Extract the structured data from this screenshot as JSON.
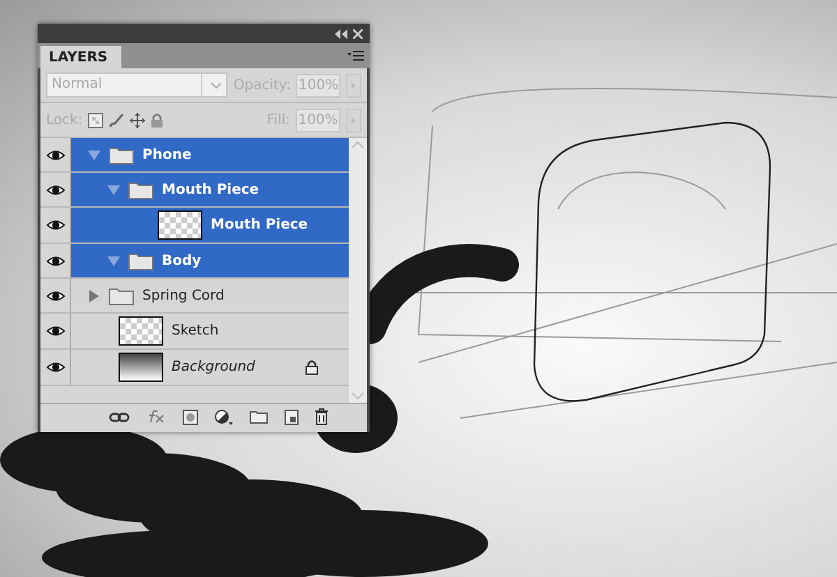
{
  "panel": {
    "tab": {
      "label": "LAYERS",
      "selected": true
    },
    "blend_mode": {
      "value": "Normal",
      "disabled": true
    },
    "opacity": {
      "label": "Opacity:",
      "value": "100%",
      "disabled": true
    },
    "lock": {
      "label": "Lock:"
    },
    "fill": {
      "label": "Fill:",
      "value": "100%",
      "disabled": true
    },
    "layers": [
      {
        "kind": "group",
        "name": "Phone",
        "visible": true,
        "selected": true,
        "expanded": true,
        "children": [
          {
            "kind": "group",
            "name": "Mouth Piece",
            "visible": true,
            "selected": true,
            "expanded": true,
            "children": [
              {
                "kind": "layer",
                "name": "Mouth Piece",
                "visible": true,
                "selected": true,
                "locked": false
              }
            ]
          },
          {
            "kind": "group",
            "name": "Body",
            "visible": true,
            "selected": true,
            "expanded": true
          }
        ]
      },
      {
        "kind": "group",
        "name": "Spring Cord",
        "visible": true,
        "selected": false,
        "expanded": false
      },
      {
        "kind": "layer",
        "name": "Sketch",
        "visible": true,
        "selected": false,
        "locked": false
      },
      {
        "kind": "gradient",
        "name": "Background",
        "visible": true,
        "selected": false,
        "locked": true
      }
    ]
  }
}
